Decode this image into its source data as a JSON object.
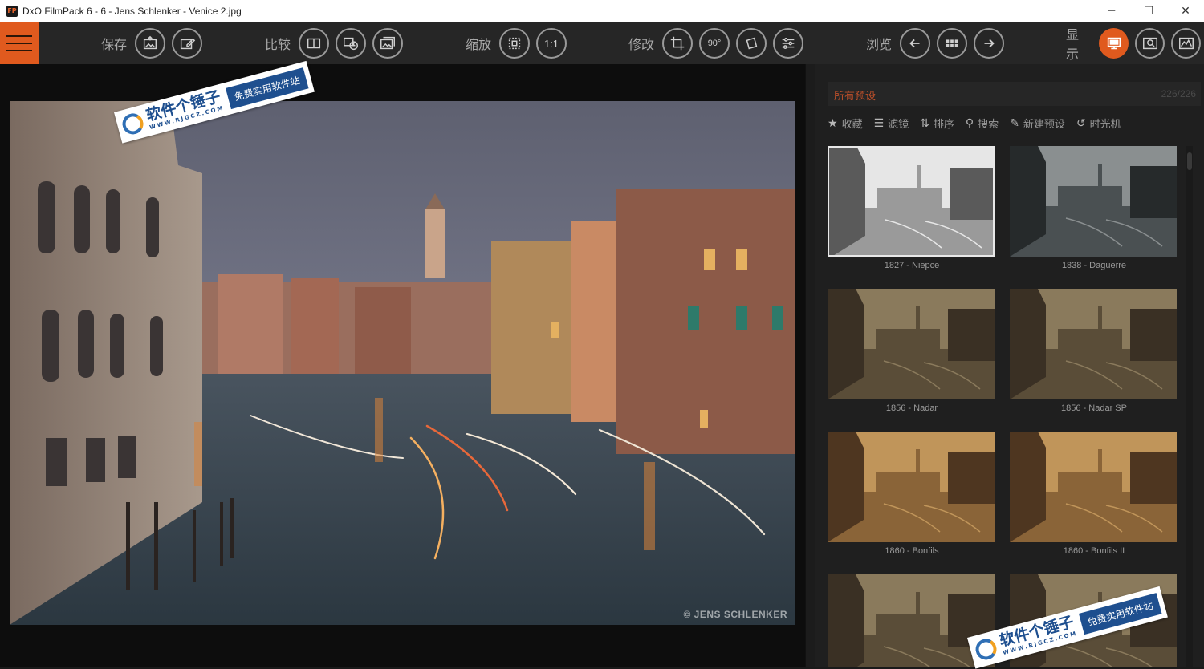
{
  "window": {
    "app_icon_text": "FP",
    "title": "DxO FilmPack 6 - 6 - Jens Schlenker - Venice 2.jpg",
    "minimize": "─",
    "maximize": "☐",
    "close": "✕"
  },
  "toolbar": {
    "save_label": "保存",
    "compare_label": "比较",
    "zoom_label": "缩放",
    "zoom_1to1": "1:1",
    "edit_label": "修改",
    "rotate_90": "90°",
    "browse_label": "浏览",
    "display_label": "显示"
  },
  "viewer": {
    "photo_credit": "© JENS SCHLENKER"
  },
  "presets": {
    "title": "所有预设",
    "count": "226/226",
    "tools": [
      {
        "icon": "★",
        "label": "收藏"
      },
      {
        "icon": "☰",
        "label": "滤镜"
      },
      {
        "icon": "⇅",
        "label": "排序"
      },
      {
        "icon": "⚲",
        "label": "搜索"
      },
      {
        "icon": "✎",
        "label": "新建预设"
      },
      {
        "icon": "↺",
        "label": "时光机"
      }
    ],
    "items": [
      {
        "name": "1827 - Niepce",
        "tone": "bw-grainy"
      },
      {
        "name": "1838 - Daguerre",
        "tone": "bw"
      },
      {
        "name": "1856 - Nadar",
        "tone": "sepia-light"
      },
      {
        "name": "1856 - Nadar SP",
        "tone": "sepia-light"
      },
      {
        "name": "1860 - Bonfils",
        "tone": "sepia"
      },
      {
        "name": "1860 - Bonfils II",
        "tone": "sepia"
      },
      {
        "name": "",
        "tone": "sepia-light"
      },
      {
        "name": "",
        "tone": "sepia-light"
      }
    ]
  },
  "watermark": {
    "main": "软件个锤子",
    "url": "WWW.RJGCZ.COM",
    "sub": "免费实用软件站"
  },
  "colors": {
    "accent": "#e05a1e",
    "toolbar_bg": "#262626",
    "panel_bg": "#1f1f1f"
  }
}
